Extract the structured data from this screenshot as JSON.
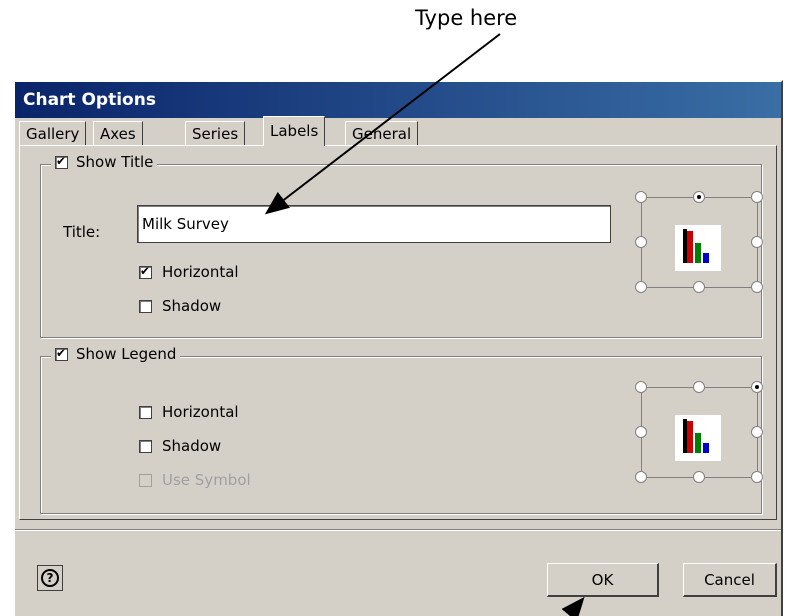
{
  "annotation": {
    "text": "Type here"
  },
  "dialog": {
    "title": "Chart Options",
    "tabs": [
      {
        "label": "Gallery"
      },
      {
        "label": "Axes"
      },
      {
        "label": "Series"
      },
      {
        "label": "Labels",
        "active": true
      },
      {
        "label": "General"
      }
    ],
    "title_group": {
      "legend": "Show Title",
      "field_label": "Title:",
      "title_value": "Milk Survey",
      "horizontal_label": "Horizontal",
      "shadow_label": "Shadow"
    },
    "legend_group": {
      "legend": "Show Legend",
      "horizontal_label": "Horizontal",
      "shadow_label": "Shadow",
      "use_symbol_label": "Use Symbol"
    },
    "footer": {
      "ok_label": "OK",
      "cancel_label": "Cancel"
    },
    "icons": {
      "help": "help-icon",
      "chart": "bar-chart-icon"
    },
    "colors": {
      "titlebar": "#0a246a",
      "face": "#d4d0c8",
      "bar_red": "#cc0000",
      "bar_green": "#008000",
      "bar_blue": "#0000cc"
    }
  }
}
